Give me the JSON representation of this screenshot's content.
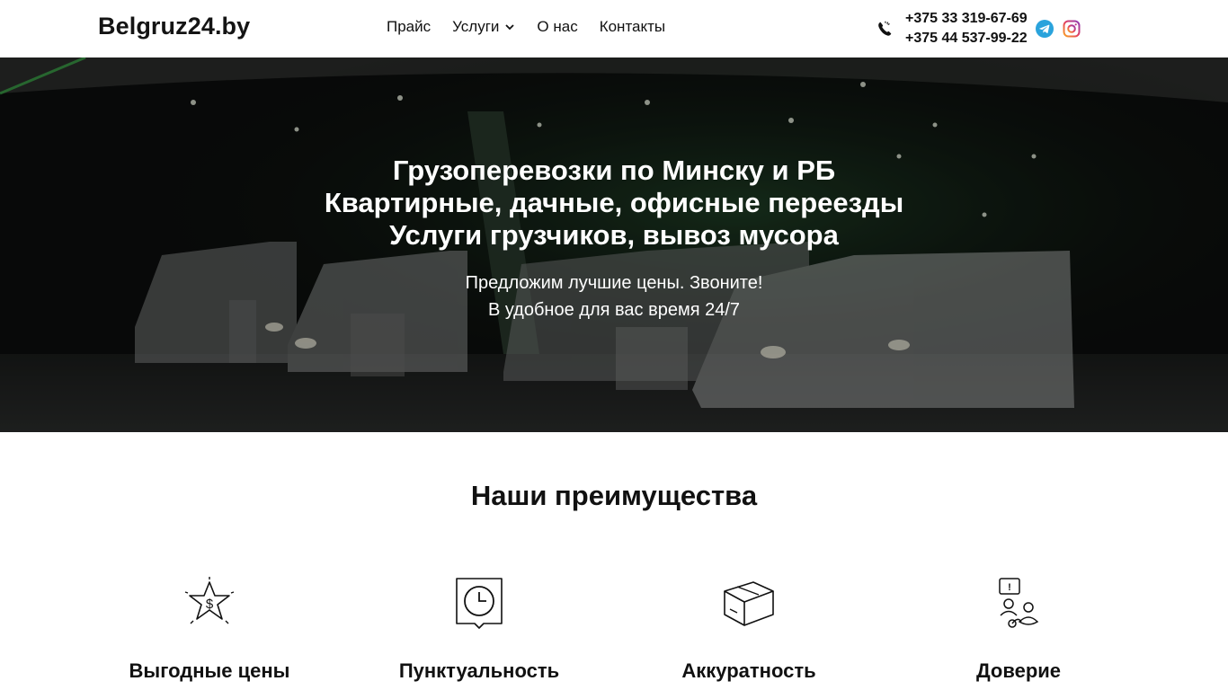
{
  "header": {
    "logo": "Belgruz24.by",
    "nav": [
      {
        "label": "Прайс"
      },
      {
        "label": "Услуги"
      },
      {
        "label": "О нас"
      },
      {
        "label": "Контакты"
      }
    ],
    "phones": [
      "+375 33 319-67-69",
      "+375 44 537-99-22"
    ]
  },
  "hero": {
    "title_lines": [
      "Грузоперевозки по Минску и РБ",
      "Квартирные, дачные, офисные переезды",
      "Услуги грузчиков, вывоз мусора"
    ],
    "subtitle_lines": [
      "Предложим лучшие цены. Звоните!",
      "В удобное для вас время 24/7"
    ]
  },
  "advantages": {
    "title": "Наши преимущества",
    "items": [
      {
        "label": "Выгодные цены",
        "icon": "star-dollar-icon"
      },
      {
        "label": "Пунктуальность",
        "icon": "clock-icon"
      },
      {
        "label": "Аккуратность",
        "icon": "box-icon"
      },
      {
        "label": "Доверие",
        "icon": "people-trust-icon"
      }
    ]
  },
  "colors": {
    "telegram": "#2aa3dc",
    "text": "#111111",
    "hero_overlay": "#000000"
  }
}
